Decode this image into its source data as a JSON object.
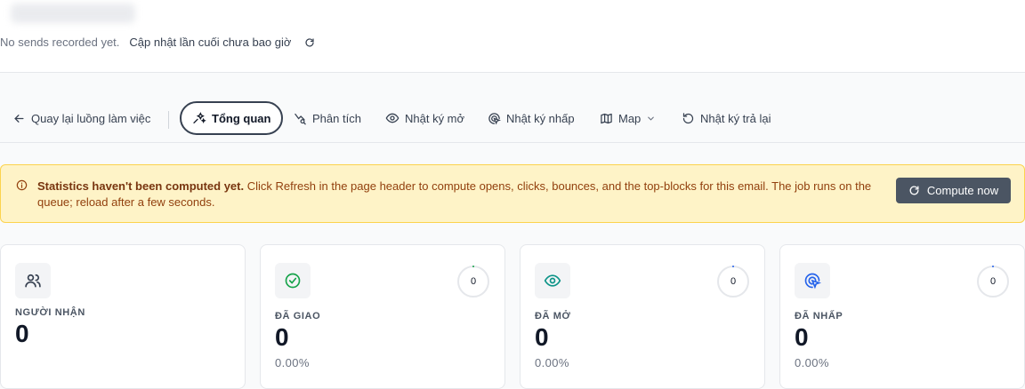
{
  "header": {
    "no_sends": "No sends recorded yet.",
    "last_updated": "Cập nhật lần cuối chưa bao giờ"
  },
  "nav": {
    "back": "Quay lại luồng làm việc",
    "tabs": [
      {
        "label": "Tổng quan",
        "active": true
      },
      {
        "label": "Phân tích"
      },
      {
        "label": "Nhật ký mở"
      },
      {
        "label": "Nhật ký nhấp"
      },
      {
        "label": "Map"
      },
      {
        "label": "Nhật ký trả lại"
      }
    ]
  },
  "banner": {
    "title": "Statistics haven't been computed yet.",
    "message": " Click Refresh in the page header to compute opens, clicks, bounces, and the top-blocks for this email. The job runs on the queue; reload after a few seconds.",
    "button": "Compute now"
  },
  "cards": [
    {
      "icon": "users-icon",
      "label": "Người nhận",
      "value": "0"
    },
    {
      "icon": "check-circle-icon",
      "label": "Đã giao",
      "value": "0",
      "percent": "0.00%",
      "ring": "0",
      "rate": 0
    },
    {
      "icon": "eye-icon",
      "label": "Đã mở",
      "value": "0",
      "percent": "0.00%",
      "ring": "0",
      "rate": 0
    },
    {
      "icon": "cursor-click-icon",
      "label": "Đã nhấp",
      "value": "0",
      "percent": "0.00%",
      "ring": "0",
      "rate": 0
    }
  ],
  "colors": {
    "banner_bg": "#fef3c7",
    "banner_text": "#92400e",
    "compute_button": "#4b5563",
    "accent_green": "#16a34a",
    "accent_teal": "#0d9488",
    "accent_blue": "#2563eb"
  }
}
